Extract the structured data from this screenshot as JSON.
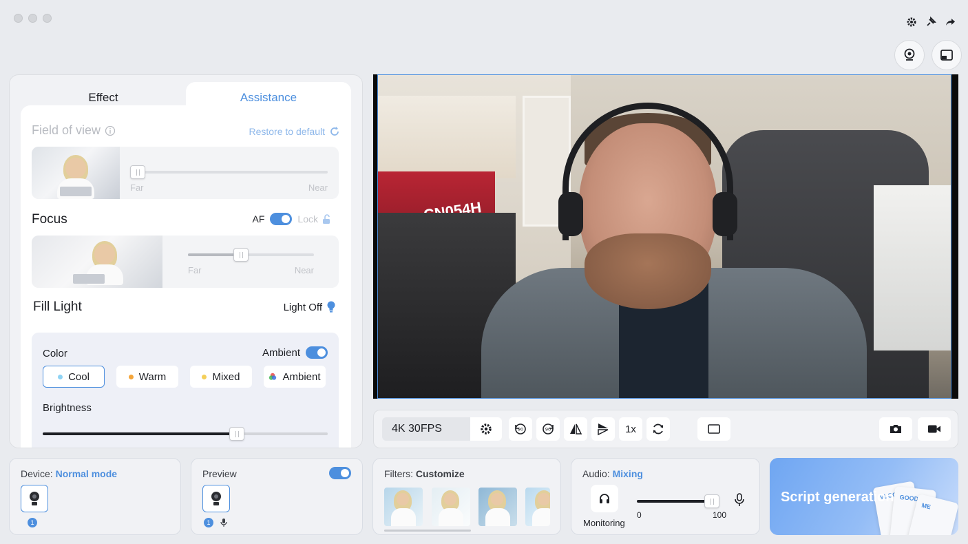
{
  "window": {
    "top_icons": [
      "gear-icon",
      "pin-icon",
      "share-icon"
    ],
    "round_buttons": [
      "webcam-icon",
      "picture-in-picture-icon"
    ]
  },
  "left_panel": {
    "tabs": [
      {
        "label": "Effect",
        "active": false
      },
      {
        "label": "Assistance",
        "active": true
      }
    ],
    "field_of_view": {
      "title": "Field of view",
      "restore_label": "Restore to default",
      "slider_value_pct": 3,
      "far_label": "Far",
      "near_label": "Near"
    },
    "focus": {
      "title": "Focus",
      "af_label": "AF",
      "af_on": true,
      "lock_label": "Lock",
      "slider_value_pct": 42,
      "far_label": "Far",
      "near_label": "Near"
    },
    "fill_light": {
      "title": "Fill Light",
      "light_state_label": "Light Off",
      "color_label": "Color",
      "ambient_label": "Ambient",
      "ambient_on": true,
      "chips": [
        {
          "label": "Cool",
          "dot_color": "#8fd3f4",
          "selected": true
        },
        {
          "label": "Warm",
          "dot_color": "#f4a53a",
          "selected": false
        },
        {
          "label": "Mixed",
          "dot_color": "#f4cf5a",
          "selected": false
        },
        {
          "label": "Ambient",
          "dot_color": "multicolor",
          "selected": false
        }
      ],
      "brightness_label": "Brightness",
      "brightness_value_pct": 68
    }
  },
  "video_overlay_text": "CN054H",
  "toolbar": {
    "resolution": "4K 30FPS",
    "zoom_label": "1x",
    "buttons": [
      "settings-icon",
      "rotate-left-90-icon",
      "rotate-right-90-icon",
      "flip-horizontal-icon",
      "flip-vertical-icon",
      "zoom-button",
      "refresh-icon",
      "aspect-ratio-icon",
      "camera-icon",
      "video-record-icon"
    ]
  },
  "device_card": {
    "title": "Device:",
    "mode": "Normal mode",
    "badge": "1"
  },
  "preview_card": {
    "title": "Preview",
    "toggle_on": true,
    "badge": "1"
  },
  "filters_card": {
    "title": "Filters:",
    "value": "Customize"
  },
  "audio_card": {
    "title": "Audio:",
    "value": "Mixing",
    "monitoring_label": "Monitoring",
    "min_label": "0",
    "max_label": "100",
    "volume_value_pct": 100
  },
  "script_card": {
    "title": "Script generation",
    "paper_labels": [
      "VLOG",
      "GOOD",
      "ME"
    ]
  },
  "colors": {
    "accent": "#4d8fde",
    "panel": "#f1f2f5",
    "background": "#e9ebef"
  }
}
